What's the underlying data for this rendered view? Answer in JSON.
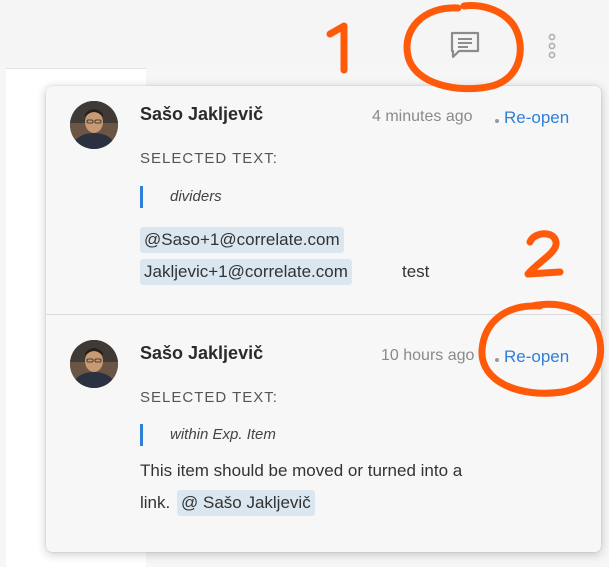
{
  "annotations": {
    "marker_1": "1",
    "marker_2": "2"
  },
  "toolbar": {
    "comment_icon": "comment-icon",
    "more_icon": "more-vertical-icon"
  },
  "comments": [
    {
      "author": "Sašo Jakljevič",
      "time": "4 minutes ago",
      "action": "Re-open",
      "selected_label": "SELECTED TEXT:",
      "selected_text": "dividers",
      "mention_line1": "@Saso+1@correlate.com",
      "mention_line2": "Jakljevic+1@correlate.com",
      "body_tail": "test"
    },
    {
      "author": "Sašo Jakljevič",
      "time": "10 hours ago",
      "action": "Re-open",
      "selected_label": "SELECTED TEXT:",
      "selected_text": "within Exp. Item",
      "body_line1": "This item should be moved or turned into a",
      "body_line2": "link.",
      "mention": "@ Sašo Jakljevič"
    }
  ],
  "colors": {
    "accent": "#2f7fd8",
    "annotation": "#ff5a0a",
    "mention_bg": "#dbe7f0"
  }
}
